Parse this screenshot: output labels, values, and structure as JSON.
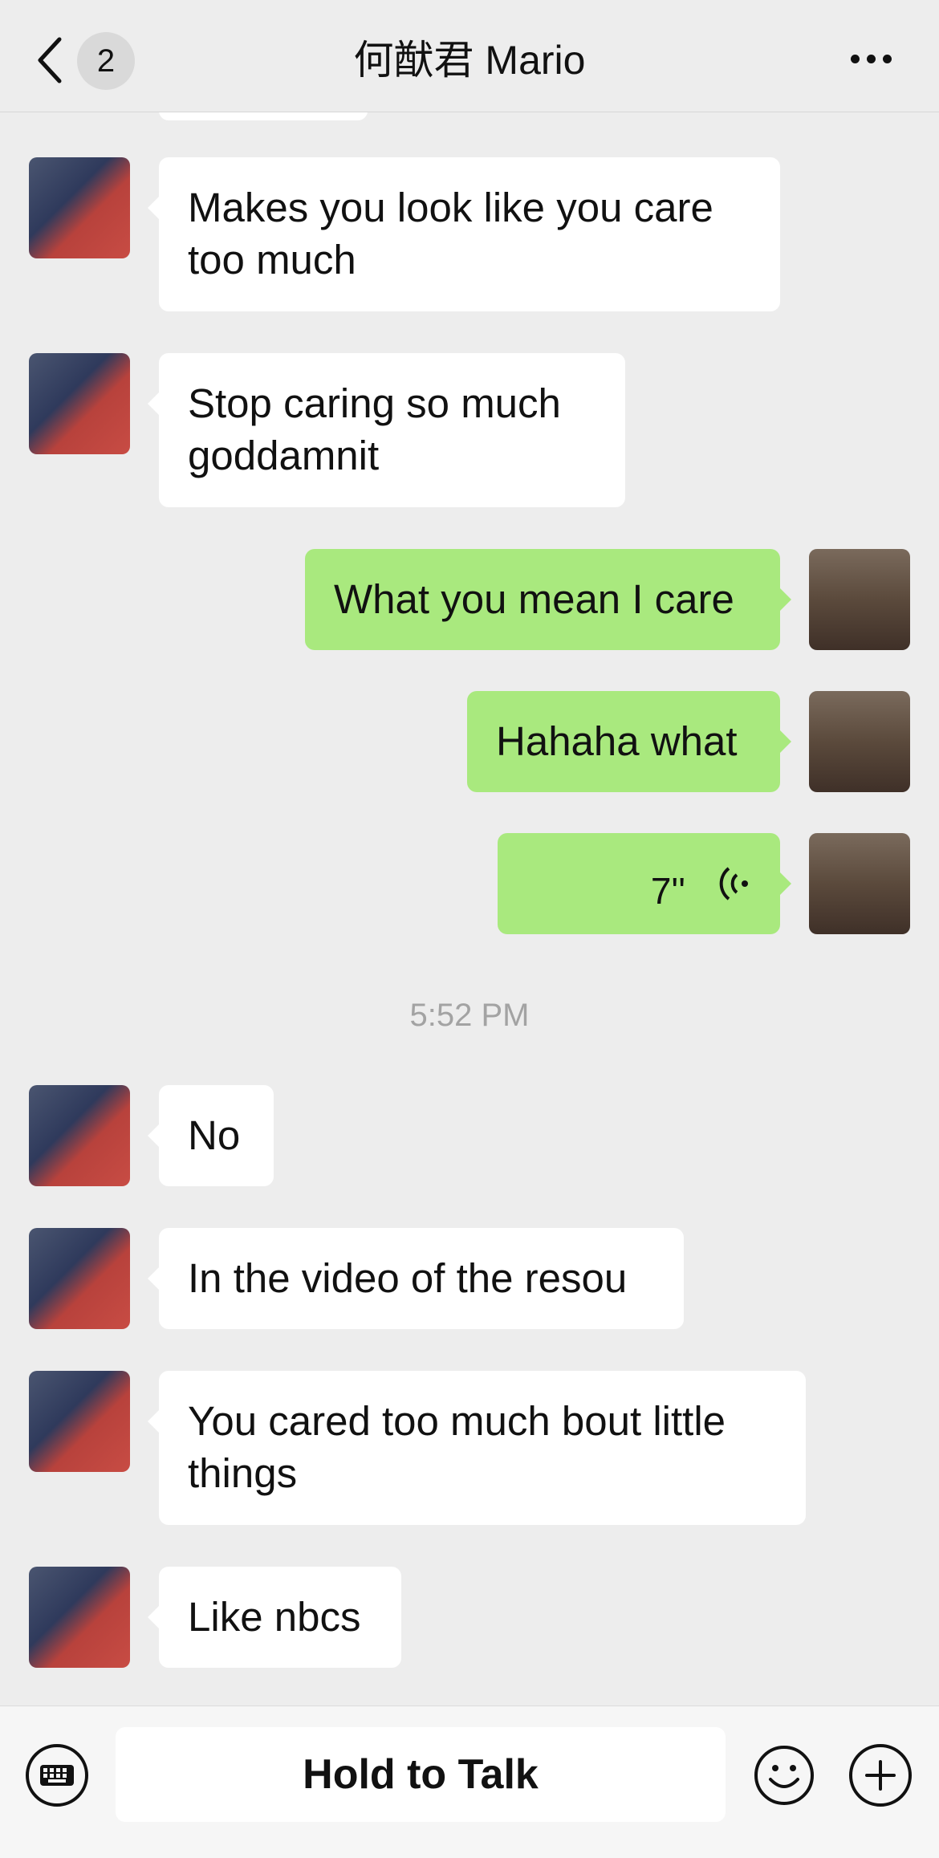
{
  "header": {
    "back_icon": "chevron-left-icon",
    "unread_count": "2",
    "title": "何猷君 Mario",
    "more_icon": "ellipsis-icon"
  },
  "colors": {
    "background": "#ededed",
    "incoming_bubble": "#ffffff",
    "outgoing_bubble": "#a9e97e"
  },
  "messages": [
    {
      "direction": "in",
      "text": "Makes you look like you care too much"
    },
    {
      "direction": "in",
      "text": "Stop caring so much goddamnit"
    },
    {
      "direction": "out",
      "text": "What you mean I care"
    },
    {
      "direction": "out",
      "text": "Hahaha what"
    },
    {
      "direction": "out",
      "type": "voice",
      "duration": "7''",
      "icon": "voice-wave-icon"
    },
    {
      "type": "timestamp",
      "text": "5:52 PM"
    },
    {
      "direction": "in",
      "text": "No"
    },
    {
      "direction": "in",
      "text": "In the video of the resou"
    },
    {
      "direction": "in",
      "text": "You cared too much bout little things"
    },
    {
      "direction": "in",
      "text": "Like nbcs"
    }
  ],
  "bottom_bar": {
    "keyboard_icon": "keyboard-icon",
    "hold_label": "Hold to Talk",
    "emoji_icon": "emoji-icon",
    "plus_icon": "plus-icon"
  }
}
